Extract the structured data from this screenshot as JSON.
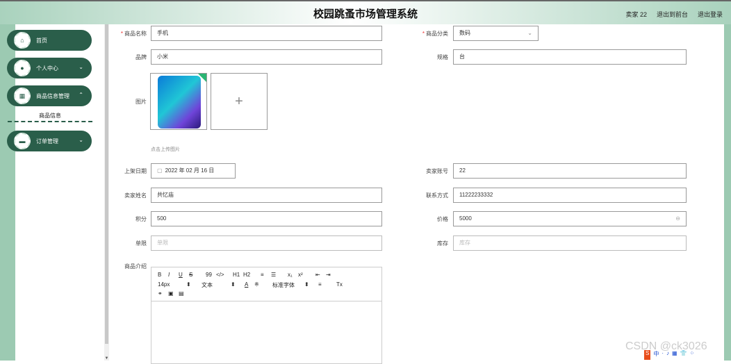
{
  "header": {
    "title": "校园跳蚤市场管理系统",
    "user": "卖家 22",
    "to_frontend": "退出到前台",
    "logout": "退出登录"
  },
  "menu": {
    "items": [
      {
        "label": "首页",
        "icon": "home-icon"
      },
      {
        "label": "个人中心",
        "icon": "user-icon"
      },
      {
        "label": "商品信息管理",
        "icon": "grid-icon"
      },
      {
        "label": "订单管理",
        "icon": "order-icon"
      }
    ],
    "submenu_item": "商品信息"
  },
  "form": {
    "name_label": "商品名称",
    "name_value": "手机",
    "category_label": "商品分类",
    "category_value": "数码",
    "brand_label": "品牌",
    "brand_value": "小米",
    "spec_label": "规格",
    "spec_value": "台",
    "image_label": "图片",
    "upload_hint": "点击上传图片",
    "date_label": "上架日期",
    "date_value": "2022 年 02 月 16 日",
    "seller_account_label": "卖家账号",
    "seller_account_value": "22",
    "seller_name_label": "卖家姓名",
    "seller_name_value": "共忆庙",
    "contact_label": "联系方式",
    "contact_value": "11222233332",
    "points_label": "积分",
    "points_value": "500",
    "price_label": "价格",
    "price_value": "5000",
    "unit_label": "单限",
    "unit_placeholder": "单限",
    "stock_label": "库存",
    "stock_placeholder": "库存",
    "intro_label": "商品介绍"
  },
  "editor": {
    "row1": [
      "B",
      "I",
      "U",
      "S",
      "99",
      "</>",
      "H1",
      "H2",
      "≡",
      "☰",
      "x₁",
      "x²",
      "⇤",
      "⇥"
    ],
    "font_size": "14px",
    "text_type": "文本",
    "font_face": "标准字体"
  },
  "watermark": "CSDN @ck3026",
  "csdn_bar": [
    "S",
    "中",
    "·",
    "♪",
    "▦",
    "👕",
    "⁘"
  ]
}
